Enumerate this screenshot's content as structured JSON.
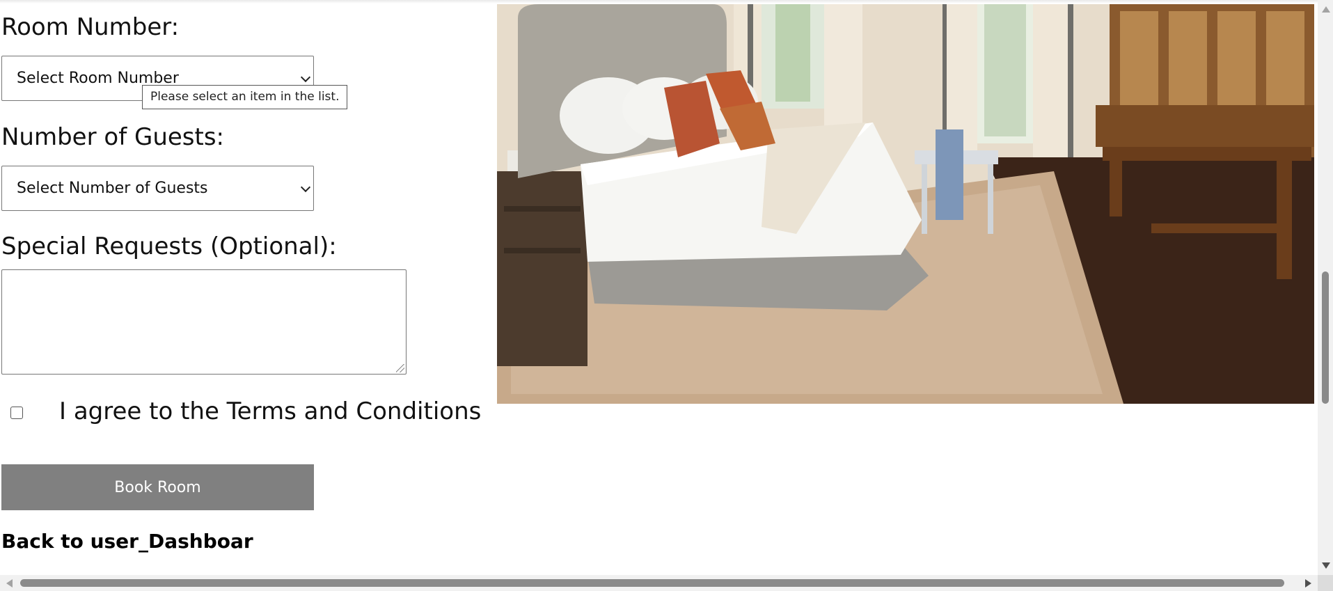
{
  "form": {
    "room_number_label": "Room Number:",
    "room_number_selected": "Select Room Number",
    "validation_tooltip": "Please select an item in the list.",
    "guests_label": "Number of Guests:",
    "guests_selected": "Select Number of Guests",
    "special_requests_label": "Special Requests (Optional):",
    "special_requests_value": "",
    "terms_checked": false,
    "terms_label": "I agree to the Terms and Conditions",
    "book_button_label": "Book Room",
    "back_link_label": "Back to user_Dashboar"
  },
  "colors": {
    "button_bg": "#808080",
    "button_text": "#ffffff"
  },
  "icons": {
    "select_arrow": "chevron-down-icon",
    "scroll_up": "scroll-up-arrow-icon",
    "scroll_down": "scroll-down-arrow-icon",
    "scroll_left": "scroll-left-arrow-icon",
    "scroll_right": "scroll-right-arrow-icon"
  }
}
